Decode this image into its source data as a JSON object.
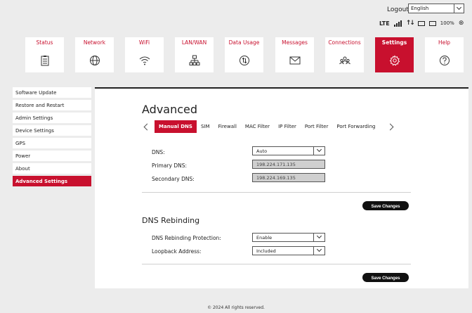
{
  "header": {
    "logout": "Logout",
    "language": "English",
    "network_type": "LTE",
    "battery": "100%"
  },
  "nav": [
    {
      "label": "Status",
      "icon": "clipboard-icon"
    },
    {
      "label": "Network",
      "icon": "globe-icon"
    },
    {
      "label": "WiFi",
      "icon": "wifi-icon"
    },
    {
      "label": "LAN/WAN",
      "icon": "lan-icon"
    },
    {
      "label": "Data Usage",
      "icon": "data-usage-icon"
    },
    {
      "label": "Messages",
      "icon": "envelope-icon"
    },
    {
      "label": "Connections",
      "icon": "users-icon"
    },
    {
      "label": "Settings",
      "icon": "gear-icon"
    },
    {
      "label": "Help",
      "icon": "help-icon"
    }
  ],
  "sidebar": [
    "Software Update",
    "Restore and Restart",
    "Admin Settings",
    "Device Settings",
    "GPS",
    "Power",
    "About",
    "Advanced Settings"
  ],
  "main": {
    "title": "Advanced",
    "tabs": [
      "Manual DNS",
      "SIM",
      "Firewall",
      "MAC Filter",
      "IP Filter",
      "Port Filter",
      "Port Forwarding"
    ],
    "dns_label": "DNS:",
    "dns_value": "Auto",
    "primary_label": "Primary DNS:",
    "primary_value": "198.224.171.135",
    "secondary_label": "Secondary DNS:",
    "secondary_value": "198.224.169.135",
    "save_label": "Save Changes",
    "rebind_title": "DNS Rebinding",
    "rebind_label": "DNS Rebinding Protection:",
    "rebind_value": "Enable",
    "loopback_label": "Loopback Address:",
    "loopback_value": "Included",
    "save2_label": "Save Changes"
  },
  "footer": "© 2024 All rights reserved.",
  "colors": {
    "accent": "#c8102e",
    "button": "#111111",
    "background": "#ececec"
  }
}
